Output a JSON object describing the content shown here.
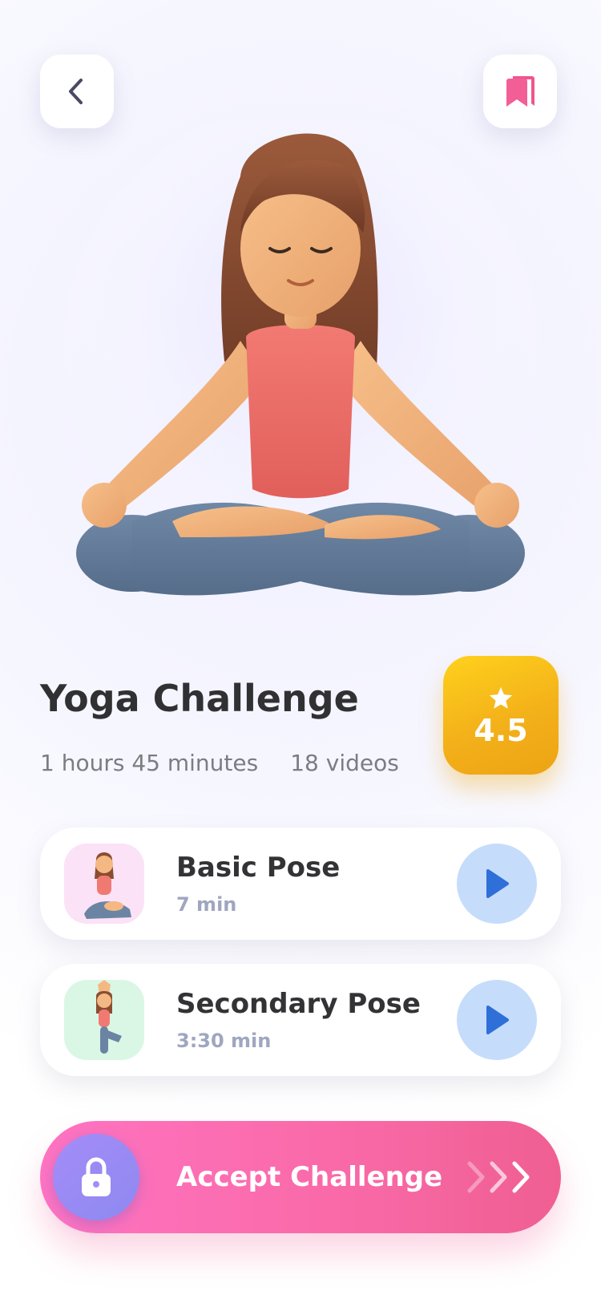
{
  "header": {
    "back_icon": "chevron-left-icon",
    "bookmark_icon": "bookmark-icon"
  },
  "hero": {
    "image": "meditating-woman-illustration"
  },
  "challenge": {
    "title": "Yoga Challenge",
    "duration": "1 hours 45 minutes",
    "videos": "18 videos",
    "rating": "4.5"
  },
  "poses": [
    {
      "name": "Basic Pose",
      "duration": "7 min",
      "thumb_color": "#fbe2f6"
    },
    {
      "name": "Secondary Pose",
      "duration": "3:30 min",
      "thumb_color": "#daf7e5"
    }
  ],
  "cta": {
    "label": "Accept Challenge",
    "lock_icon": "lock-icon",
    "arrows_icon": "triple-chevron-right-icon"
  },
  "colors": {
    "accent_pink": "#f56ea8",
    "rating_gold": "#f3b11a",
    "play_blue": "#2f6fd8",
    "lock_purple": "#9a8bf5"
  }
}
